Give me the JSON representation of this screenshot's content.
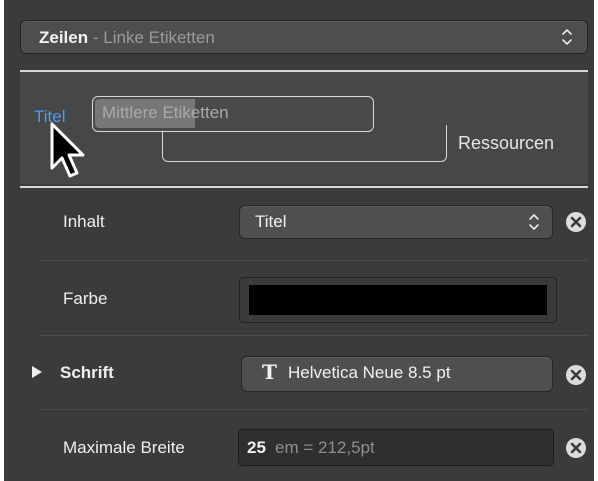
{
  "header_select": {
    "value_main": "Zeilen",
    "separator": "-",
    "value_sub": "Linke Etiketten"
  },
  "labels_area": {
    "active_tab": "Titel",
    "dragged_label": "Mittlere Etiketten",
    "ressourcen_label": "Ressourcen"
  },
  "inspector": {
    "inhalt": {
      "label": "Inhalt",
      "value": "Titel"
    },
    "farbe": {
      "label": "Farbe",
      "color": "#000000"
    },
    "schrift": {
      "label": "Schrift",
      "value": "Helvetica Neue 8.5 pt",
      "font_glyph": "T"
    },
    "max_breite": {
      "label": "Maximale Breite",
      "value": "25",
      "unit_text": "em = 212,5pt"
    }
  },
  "colors": {
    "panel_bg": "#3b3b3b",
    "accent_blue": "#4a9cf5",
    "separator": "#d6d6d6"
  }
}
